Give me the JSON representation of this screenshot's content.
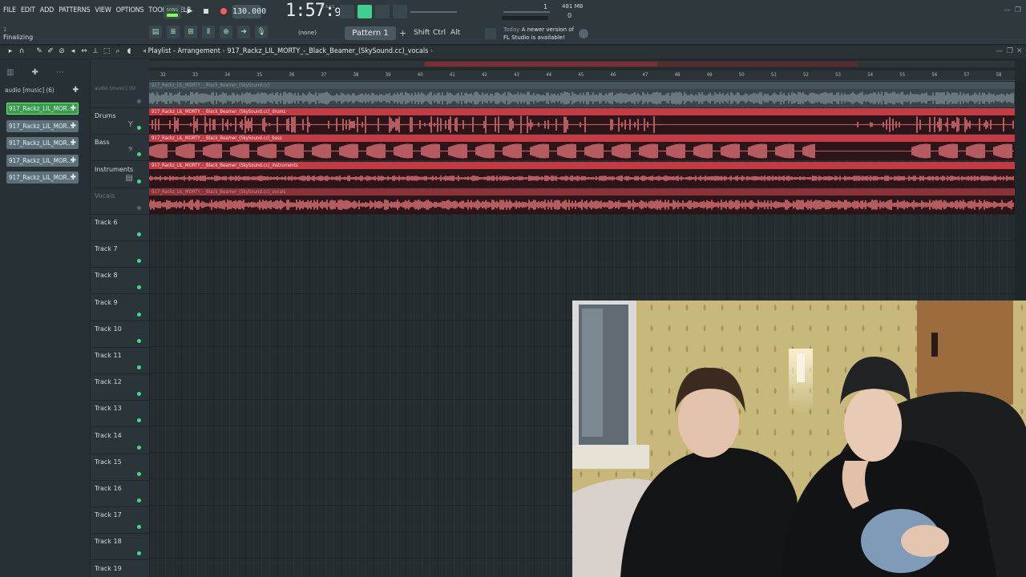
{
  "menu": [
    "FILE",
    "EDIT",
    "ADD",
    "PATTERNS",
    "VIEW",
    "OPTIONS",
    "TOOLS",
    "HELP"
  ],
  "status_hint": "Finalizing",
  "status_tick": "1",
  "transport": {
    "song_label": "SONG",
    "tempo": "130.000",
    "time_main": "1:57:",
    "time_small": "99",
    "time_unit": "M:S:CS",
    "pattern_num": "1",
    "pattern_zero": "0",
    "memory": "481 MB"
  },
  "snap": "(none)",
  "pattern": "Pattern 1",
  "keys": {
    "shift": "Shift",
    "ctrl": "Ctrl",
    "alt": "Alt"
  },
  "news": {
    "today": "Today",
    "line1": "A newer version of",
    "line2": "FL Studio is available!"
  },
  "breadcrumb": {
    "root": "Playlist - Arrangement",
    "clip": "917_Rackz_LIL_MORTY_-_Black_Beamer_(SkySound.cc)_vocals"
  },
  "browser": {
    "folder": "audio [music] (6)",
    "clips": [
      "917_Rackz_LIL_MOR...",
      "917_Rackz_LIL_MOR...",
      "917_Rackz_LIL_MOR...",
      "917_Rackz_LIL_MOR...",
      "917_Rackz_LIL_MOR..."
    ]
  },
  "ruler": [
    "32",
    "33",
    "34",
    "35",
    "36",
    "37",
    "38",
    "39",
    "40",
    "41",
    "42",
    "43",
    "44",
    "45",
    "46",
    "47",
    "48",
    "49",
    "50",
    "51",
    "52",
    "53",
    "54",
    "55",
    "56",
    "57",
    "58"
  ],
  "tracks": [
    {
      "name": "audio [music] (6)",
      "clip": "917_Rackz_LIL_MORTY_-_Black_Beamer_(SkySound.cc)",
      "style": "ghost"
    },
    {
      "name": "Drums",
      "clip": "917_Rackz_LIL_MORTY_-_Black_Beamer_(SkySound.cc)_drums",
      "style": "red"
    },
    {
      "name": "Bass",
      "clip": "917_Rackz_LIL_MORTY_-_Black_Beamer_(SkySound.cc)_bass",
      "style": "red"
    },
    {
      "name": "Instruments",
      "clip": "917_Rackz_LIL_MORTY_-_Black_Beamer_(SkySound.cc)_instruments",
      "style": "red"
    },
    {
      "name": "Vocals",
      "clip": "917_Rackz_LIL_MORTY_-_Black_Beamer_(SkySound.cc)_vocals",
      "style": "faded"
    },
    {
      "name": "Track 6"
    },
    {
      "name": "Track 7"
    },
    {
      "name": "Track 8"
    },
    {
      "name": "Track 9"
    },
    {
      "name": "Track 10"
    },
    {
      "name": "Track 11"
    },
    {
      "name": "Track 12"
    },
    {
      "name": "Track 13"
    },
    {
      "name": "Track 14"
    },
    {
      "name": "Track 15"
    },
    {
      "name": "Track 16"
    },
    {
      "name": "Track 17"
    },
    {
      "name": "Track 18"
    },
    {
      "name": "Track 19"
    }
  ],
  "colors": {
    "accent_green": "#3ee07c",
    "clip_red": "#c23a44",
    "wave_red": "#f07a80"
  },
  "icons": [
    "song-mode-icon",
    "play-icon",
    "stop-icon",
    "record-icon",
    "playlist-icon",
    "piano-roll-icon",
    "mixer-icon",
    "channel-rack-icon",
    "mic-icon",
    "pencil-icon",
    "paint-icon",
    "delete-icon",
    "mute-icon",
    "slice-icon",
    "select-icon",
    "zoom-icon",
    "playback-icon",
    "browser-icon",
    "minimize-icon",
    "close-icon"
  ]
}
